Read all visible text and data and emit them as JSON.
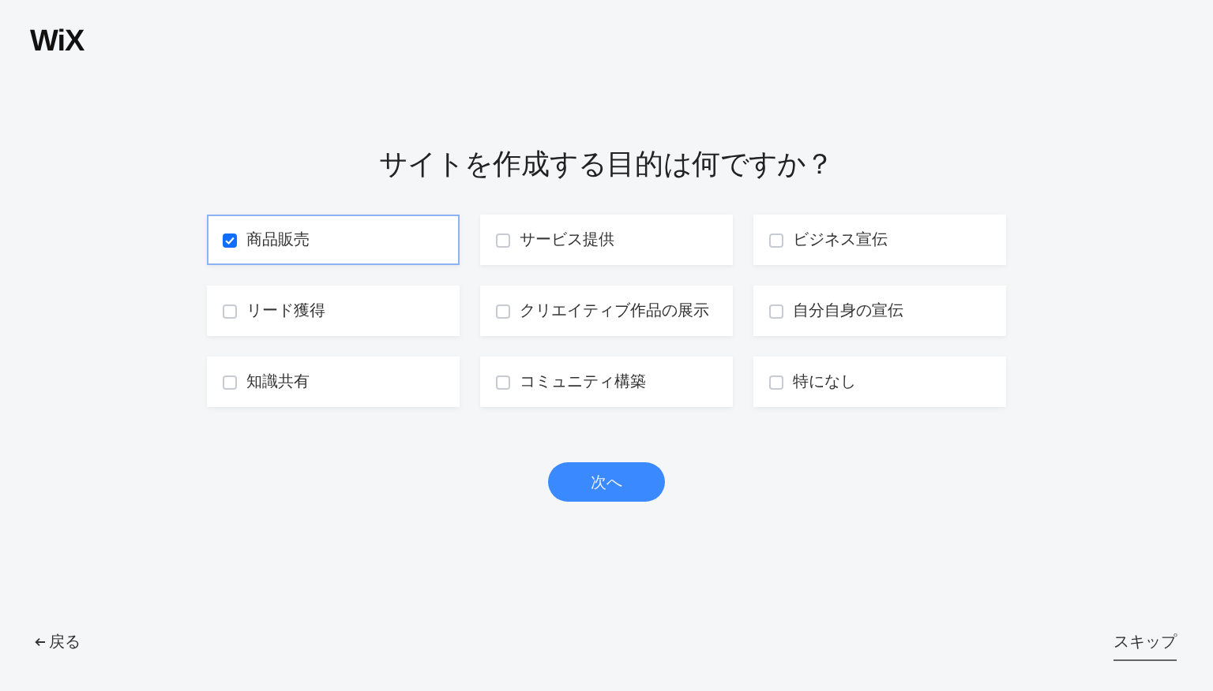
{
  "logo": "WiX",
  "title": "サイトを作成する目的は何ですか？",
  "options": [
    {
      "label": "商品販売",
      "checked": true
    },
    {
      "label": "サービス提供",
      "checked": false
    },
    {
      "label": "ビジネス宣伝",
      "checked": false
    },
    {
      "label": "リード獲得",
      "checked": false
    },
    {
      "label": "クリエイティブ作品の展示",
      "checked": false
    },
    {
      "label": "自分自身の宣伝",
      "checked": false
    },
    {
      "label": "知識共有",
      "checked": false
    },
    {
      "label": "コミュニティ構築",
      "checked": false
    },
    {
      "label": "特になし",
      "checked": false
    }
  ],
  "next_button": "次へ",
  "back_link": "戻る",
  "skip_link": "スキップ"
}
